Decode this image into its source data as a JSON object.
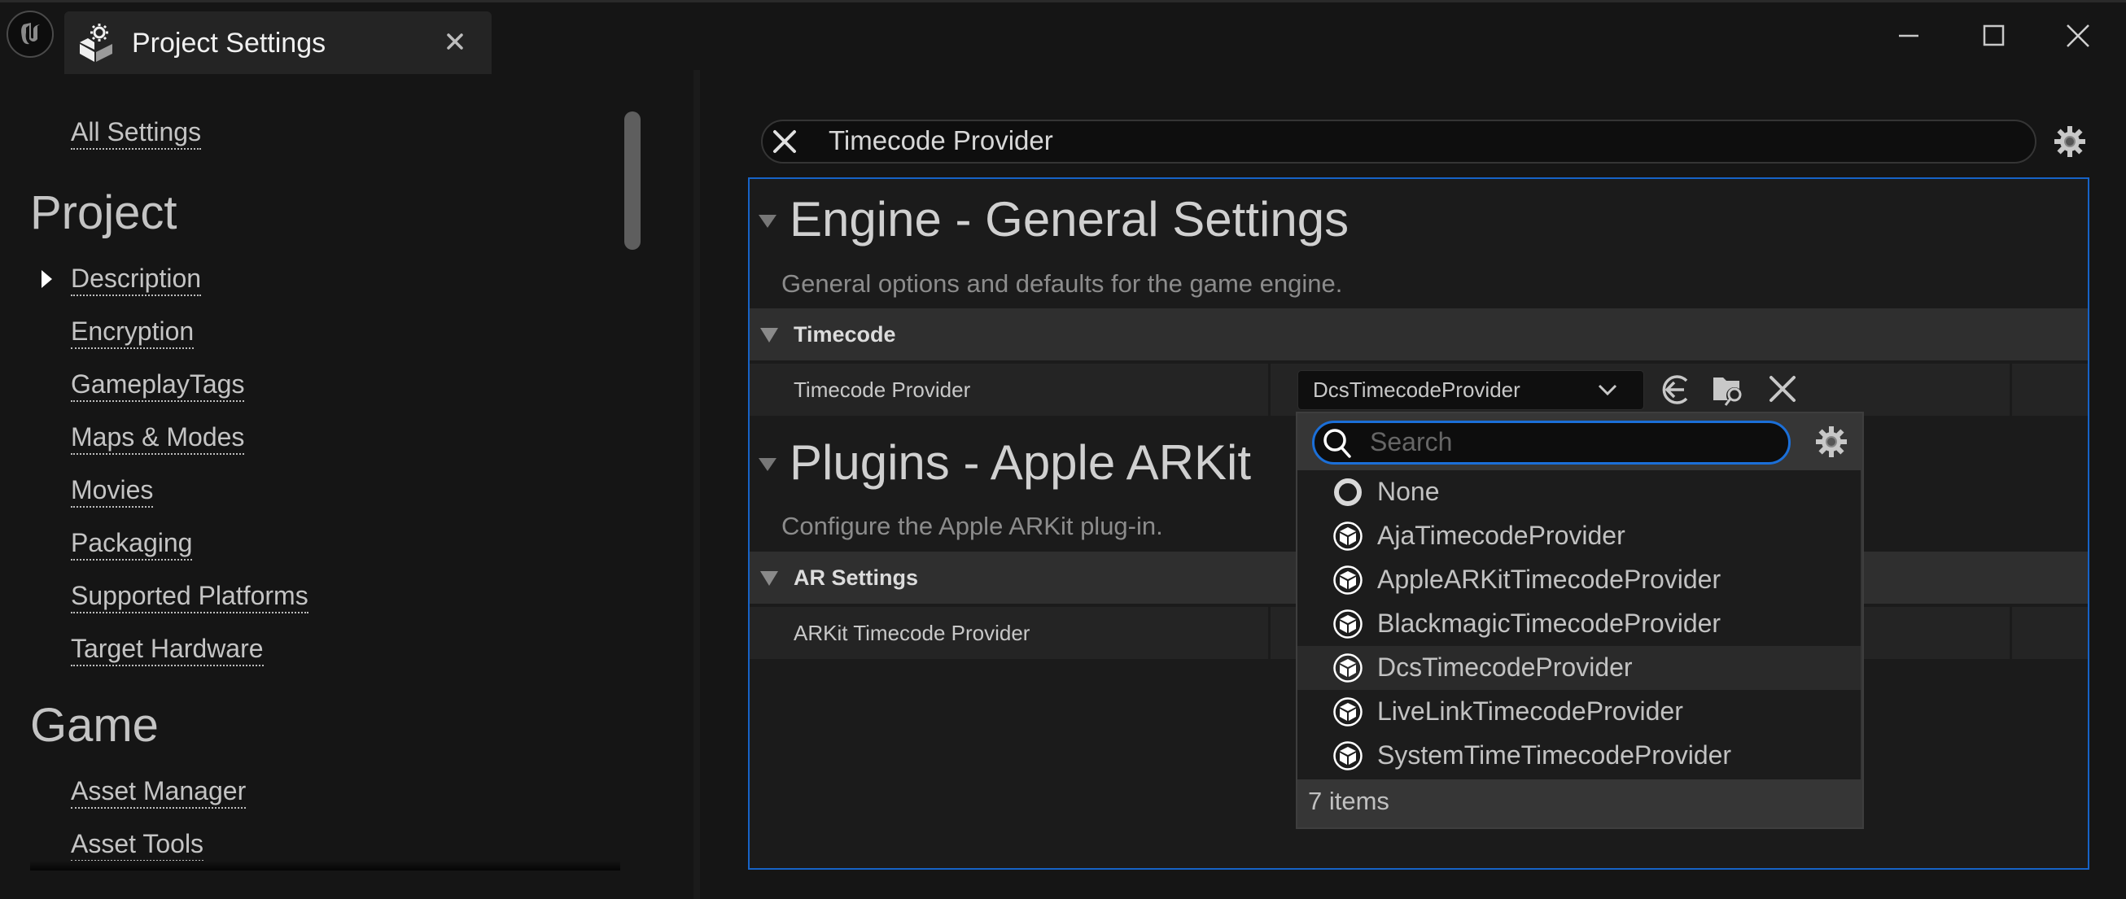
{
  "window": {
    "tab_title": "Project Settings",
    "icons": {
      "logo": "unreal-logo-icon",
      "tab": "project-settings-icon",
      "tab_close": "close-icon",
      "minimize": "minimize-icon",
      "maximize": "maximize-icon",
      "close": "close-icon"
    }
  },
  "sidebar": {
    "all_settings": "All Settings",
    "sections": [
      {
        "heading": "Project",
        "items": [
          "Description",
          "Encryption",
          "GameplayTags",
          "Maps & Modes",
          "Movies",
          "Packaging",
          "Supported Platforms",
          "Target Hardware"
        ]
      },
      {
        "heading": "Game",
        "items": [
          "Asset Manager",
          "Asset Tools"
        ]
      }
    ],
    "expanded_item": "Description"
  },
  "search": {
    "value": "Timecode Provider"
  },
  "details": {
    "sections": [
      {
        "title": "Engine - General Settings",
        "description": "General options and defaults for the game engine.",
        "category": "Timecode",
        "property": {
          "label": "Timecode Provider",
          "value": "DcsTimecodeProvider"
        }
      },
      {
        "title": "Plugins - Apple ARKit",
        "description": "Configure the Apple ARKit plug-in.",
        "category": "AR Settings",
        "property": {
          "label": "ARKit Timecode Provider",
          "value": ""
        }
      }
    ],
    "property_buttons": [
      "reset-to-default",
      "browse-to-asset",
      "clear"
    ]
  },
  "popup": {
    "search_placeholder": "Search",
    "options": [
      {
        "label": "None",
        "icon": "none-circle-icon",
        "selected": false
      },
      {
        "label": "AjaTimecodeProvider",
        "icon": "class-icon",
        "selected": false
      },
      {
        "label": "AppleARKitTimecodeProvider",
        "icon": "class-icon",
        "selected": false
      },
      {
        "label": "BlackmagicTimecodeProvider",
        "icon": "class-icon",
        "selected": false
      },
      {
        "label": "DcsTimecodeProvider",
        "icon": "class-icon",
        "selected": true
      },
      {
        "label": "LiveLinkTimecodeProvider",
        "icon": "class-icon",
        "selected": false
      },
      {
        "label": "SystemTimeTimecodeProvider",
        "icon": "class-icon",
        "selected": false
      }
    ],
    "count_label": "7 items"
  },
  "colors": {
    "accent_blue": "#1763c7",
    "background": "#151515",
    "panel": "#1b1b1b",
    "category": "#2f2f2f",
    "row": "#242424"
  }
}
